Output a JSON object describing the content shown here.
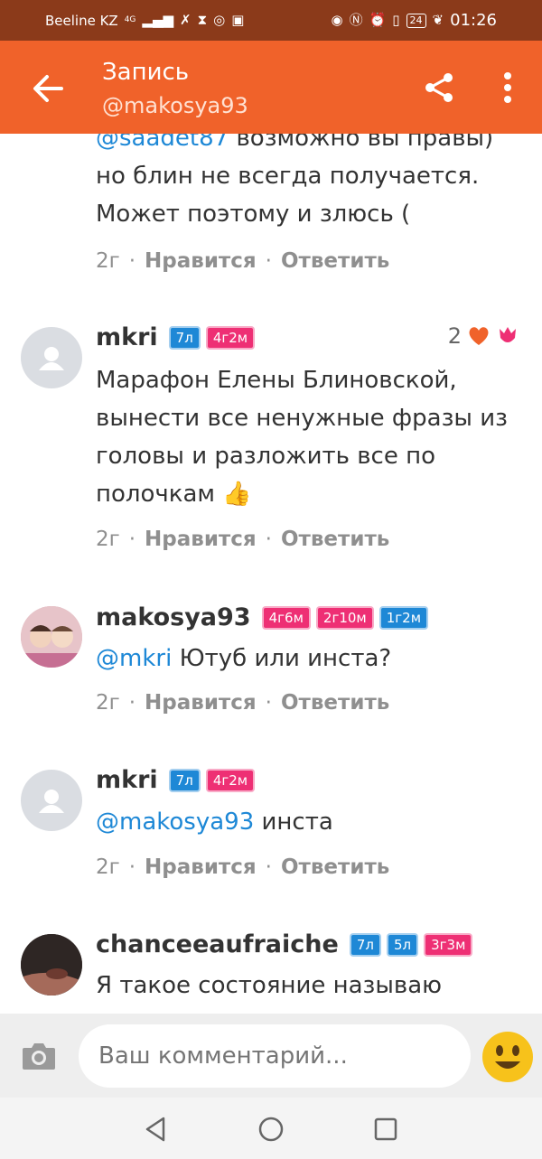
{
  "status_bar": {
    "carrier": "Beeline KZ",
    "network": "4G",
    "battery": "24",
    "time": "01:26"
  },
  "app_bar": {
    "title": "Запись",
    "subtitle": "@makosya93"
  },
  "comments": [
    {
      "mention": "@saadet87",
      "text": "возможно вы правы) но блин не всегда получается. Может поэтому и злюсь (",
      "time": "2г",
      "like_label": "Нравится",
      "reply_label": "Ответить"
    },
    {
      "author": "mkri",
      "badges": [
        "7л",
        "4г2м"
      ],
      "likes": "2",
      "text": "Марафон Елены Блиновской, вынести все ненужные фразы из головы и разложить все по полочкам 👍",
      "time": "2г",
      "like_label": "Нравится",
      "reply_label": "Ответить"
    },
    {
      "author": "makosya93",
      "badges": [
        "4г6м",
        "2г10м",
        "1г2м"
      ],
      "mention": "@mkri",
      "text": "Ютуб или инста?",
      "time": "2г",
      "like_label": "Нравится",
      "reply_label": "Ответить"
    },
    {
      "author": "mkri",
      "badges": [
        "7л",
        "4г2м"
      ],
      "mention": "@makosya93",
      "text": "инста",
      "time": "2г",
      "like_label": "Нравится",
      "reply_label": "Ответить"
    },
    {
      "author": "chanceeaufraiche",
      "badges": [
        "7л",
        "5л",
        "3г3м"
      ],
      "text": "Я такое состояние называю",
      "time": "",
      "like_label": "",
      "reply_label": ""
    }
  ],
  "input": {
    "placeholder": "Ваш комментарий..."
  },
  "colors": {
    "accent": "#f0622a",
    "status_bar": "#8b3a1a",
    "link": "#1e88d6",
    "badge_blue": "#1e88d6",
    "badge_pink": "#ee2f74"
  }
}
